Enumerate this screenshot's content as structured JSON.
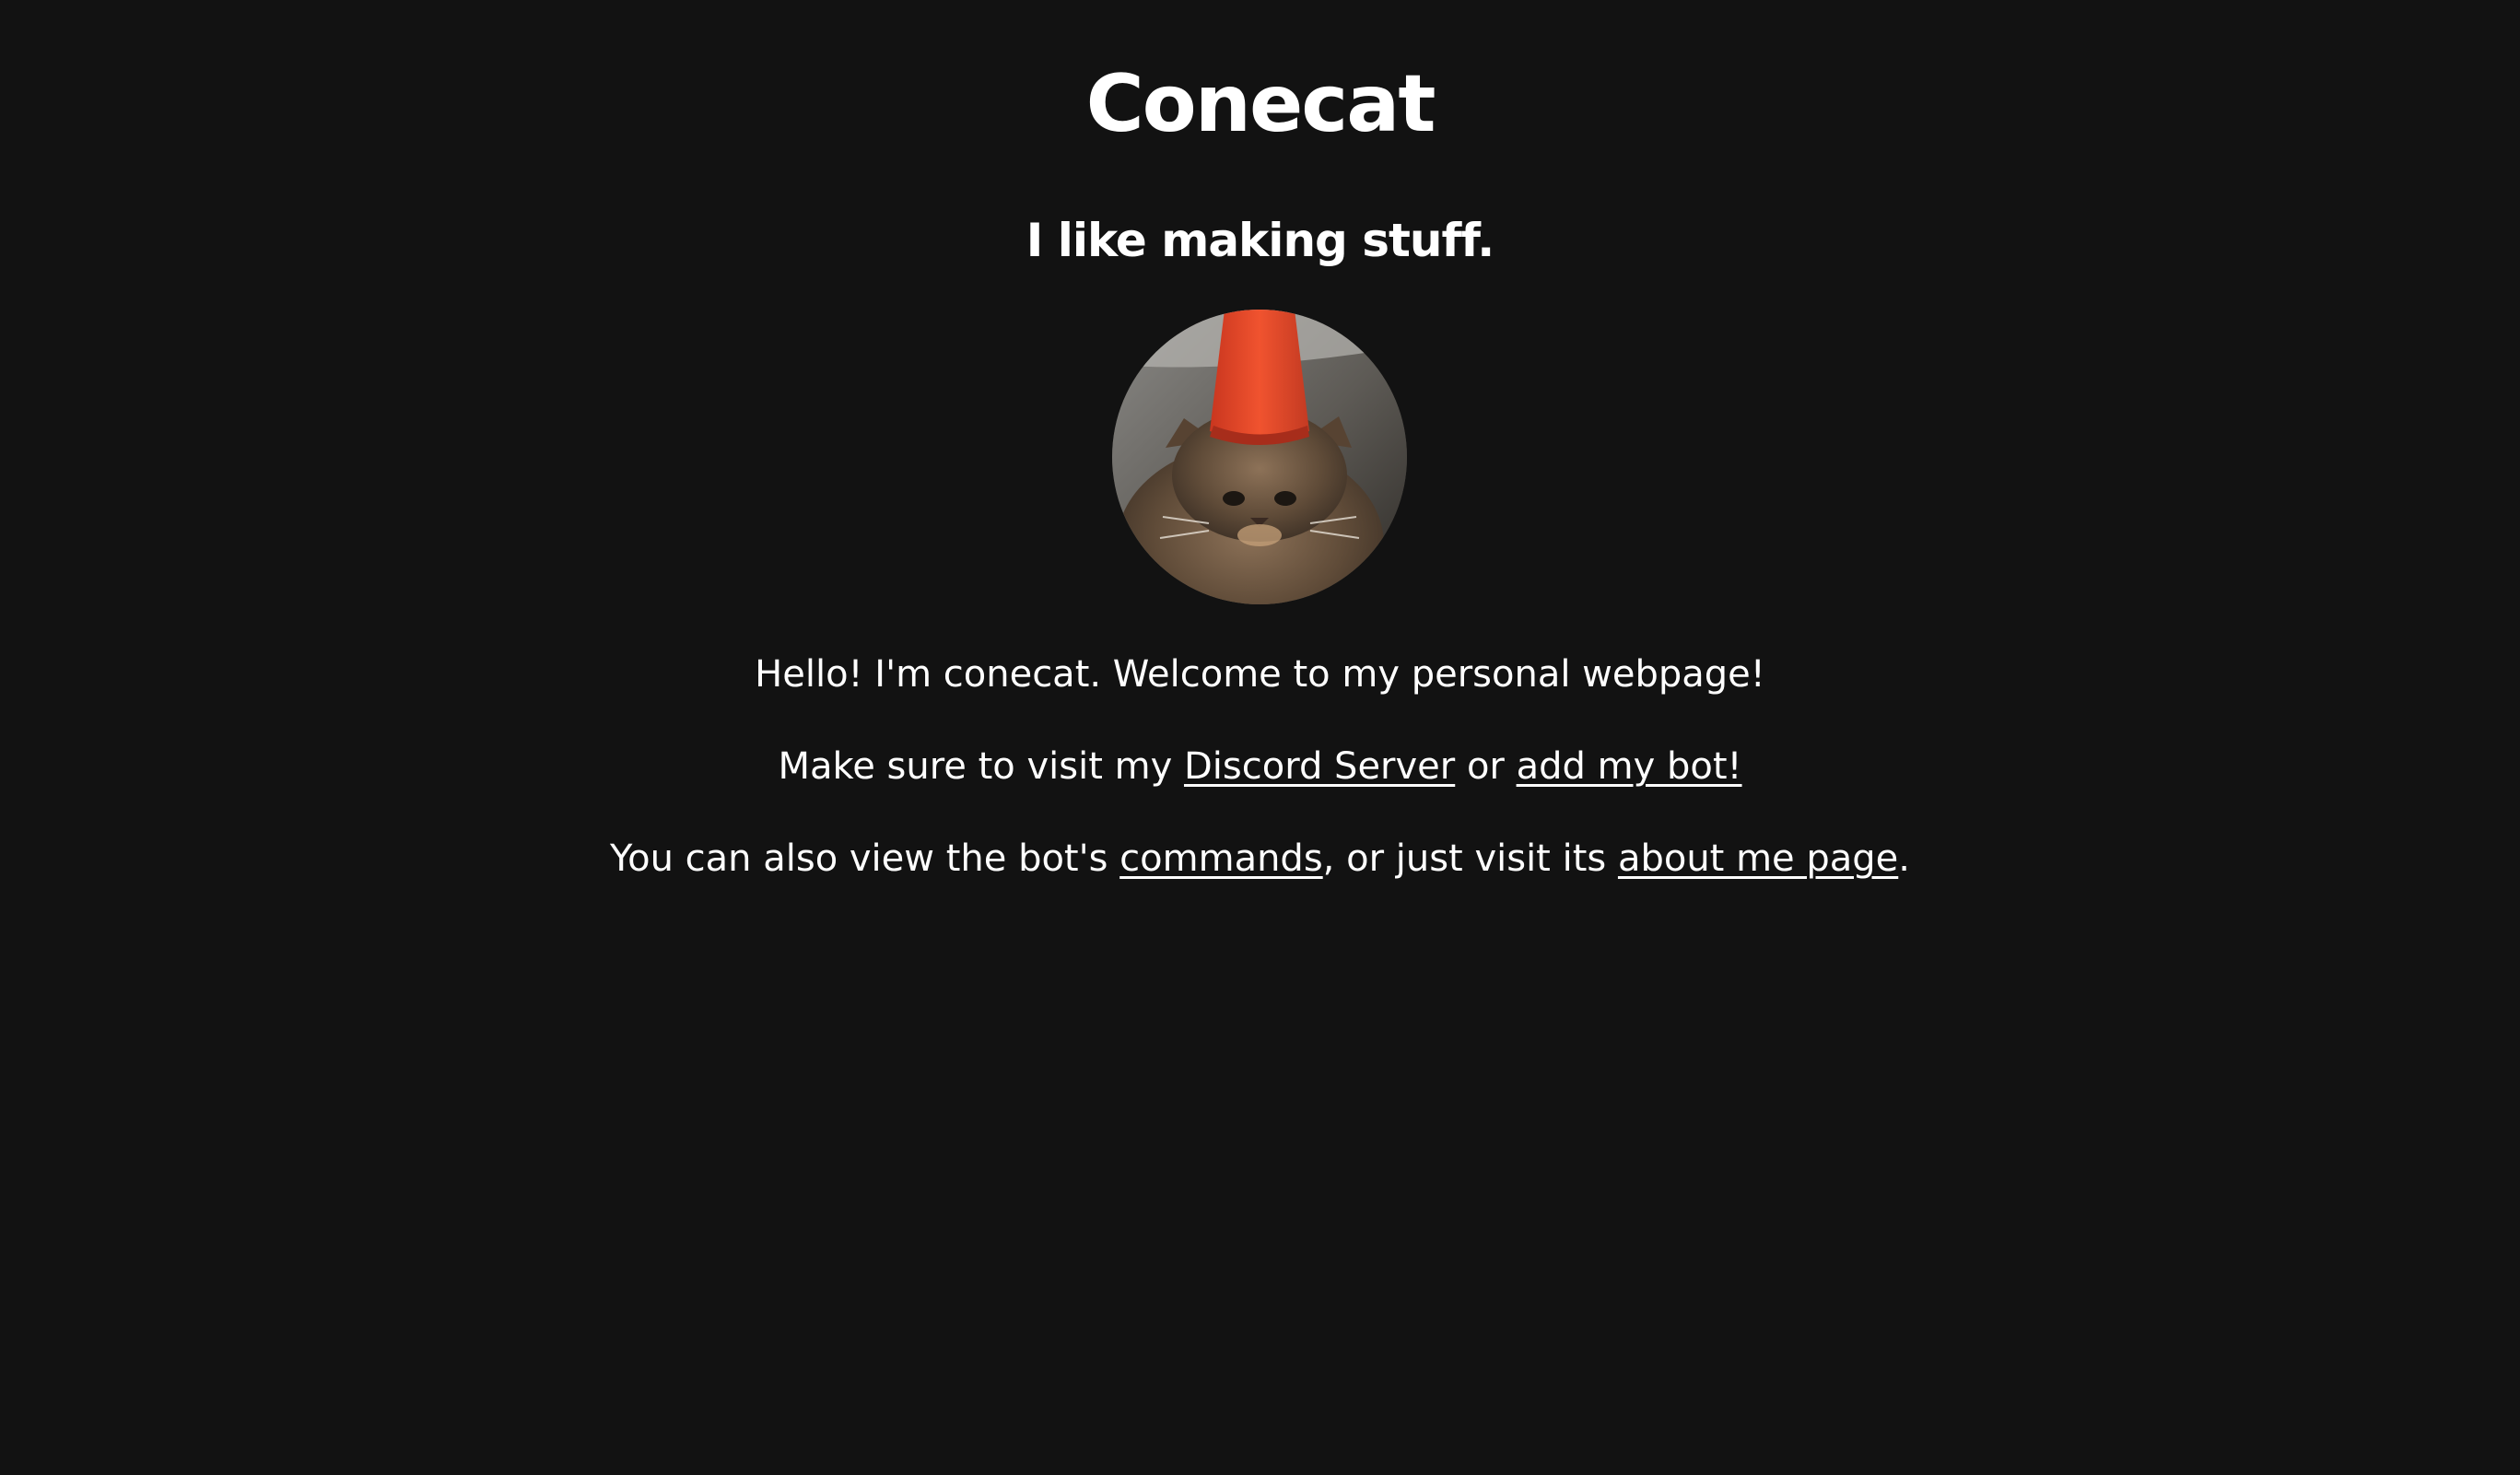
{
  "header": {
    "title": "Conecat",
    "tagline": "I like making stuff."
  },
  "avatar": {
    "icon": "cat-with-traffic-cone-photo",
    "accent_color": "#e8482b"
  },
  "content": {
    "welcome": "Hello! I'm conecat. Welcome to my personal webpage!",
    "visit_prefix": "Make sure to visit my ",
    "discord_link": "Discord Server",
    "visit_middle": " or ",
    "bot_link": "add my bot!",
    "commands_prefix": "You can also view the bot's ",
    "commands_link": "commands",
    "commands_middle": ", or just visit its ",
    "about_link": "about me page",
    "commands_suffix": "."
  },
  "theme": {
    "background": "#121212",
    "text": "#ffffff"
  }
}
